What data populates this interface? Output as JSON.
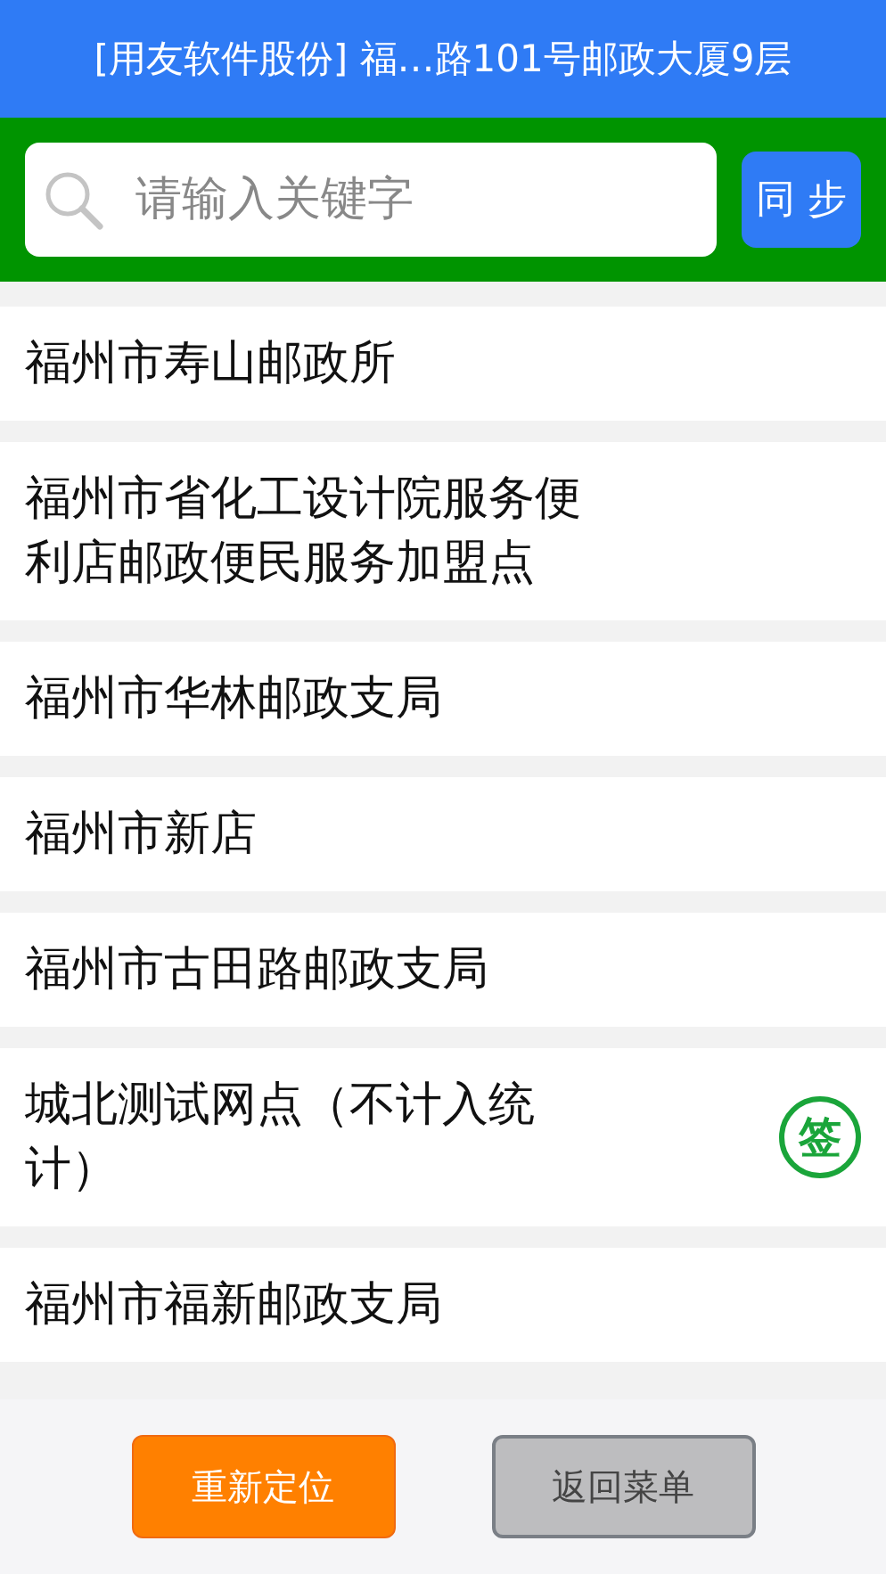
{
  "title": "[用友软件股份] 福…路101号邮政大厦9层",
  "search": {
    "placeholder": "请输入关键字"
  },
  "sync_button": "同 步",
  "items": [
    {
      "name": "福州市寿山邮政所"
    },
    {
      "name": "福州市省化工设计院服务便利店邮政便民服务加盟点"
    },
    {
      "name": "福州市华林邮政支局"
    },
    {
      "name": "福州市新店"
    },
    {
      "name": "福州市古田路邮政支局"
    },
    {
      "name": "城北测试网点（不计入统计）",
      "badge": "签"
    },
    {
      "name": "福州市福新邮政支局"
    }
  ],
  "buttons": [
    {
      "label": "重新定位",
      "kind": "primary"
    },
    {
      "label": "返回菜单",
      "kind": "secondary"
    }
  ]
}
